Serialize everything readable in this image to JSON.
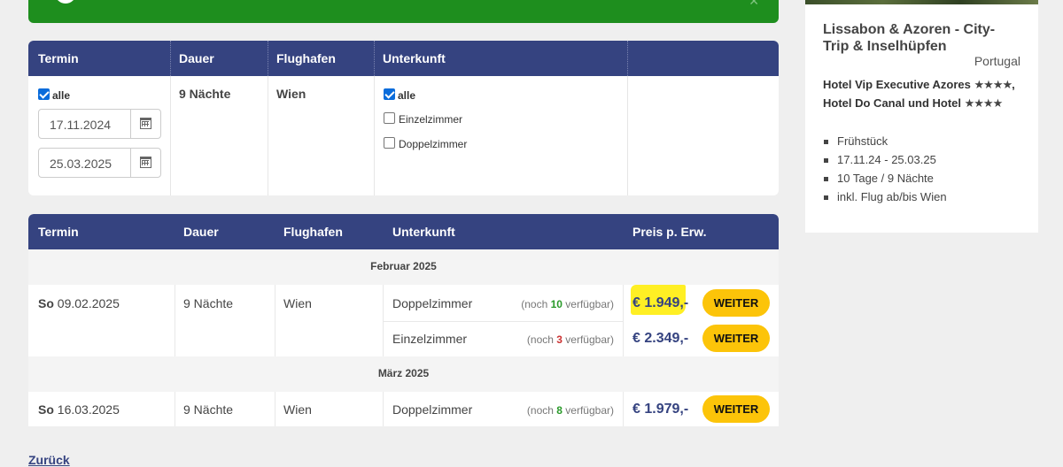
{
  "filter": {
    "headers": [
      "Termin",
      "Dauer",
      "Flughafen",
      "Unterkunft",
      ""
    ],
    "termin_all_label": "alle",
    "date_from": "17.11.2024",
    "date_to": "25.03.2025",
    "dauer": "9 Nächte",
    "flughafen": "Wien",
    "unterkunft_options": [
      {
        "label": "alle",
        "checked": true
      },
      {
        "label": "Einzelzimmer",
        "checked": false
      },
      {
        "label": "Doppelzimmer",
        "checked": false
      }
    ]
  },
  "results": {
    "headers": [
      "Termin",
      "Dauer",
      "Flughafen",
      "Unterkunft",
      "Preis p. Erw."
    ],
    "months": [
      {
        "label": "Februar 2025",
        "rows": [
          {
            "weekday": "So",
            "date": "09.02.2025",
            "dauer": "9 Nächte",
            "flughafen": "Wien",
            "options": [
              {
                "room": "Doppelzimmer",
                "avail_prefix": "(noch ",
                "avail_count": "10",
                "avail_suffix": " verfügbar)",
                "price": "€ 1.949,-",
                "button": "WEITER"
              },
              {
                "room": "Einzelzimmer",
                "avail_prefix": "(noch ",
                "avail_count": "3",
                "avail_suffix": " verfügbar)",
                "price": "€ 2.349,-",
                "button": "WEITER"
              }
            ]
          }
        ]
      },
      {
        "label": "März 2025",
        "rows": [
          {
            "weekday": "So",
            "date": "16.03.2025",
            "dauer": "9 Nächte",
            "flughafen": "Wien",
            "options": [
              {
                "room": "Doppelzimmer",
                "avail_prefix": "(noch ",
                "avail_count": "8",
                "avail_suffix": " verfügbar)",
                "price": "€ 1.979,-",
                "button": "WEITER"
              }
            ]
          }
        ]
      }
    ]
  },
  "back_link": "Zurück",
  "card": {
    "title": "Lissabon & Azoren - City-Trip & Inselhüpfen",
    "country": "Portugal",
    "hotel_part1": "Hotel Vip Executive Azores ",
    "hotel_stars1": "★★★★",
    "hotel_part2": ", Hotel Do Canal und Hotel ",
    "hotel_stars2": "★★★★",
    "features": [
      "Frühstück",
      "17.11.24 - 25.03.25",
      "10 Tage / 9 Nächte",
      "inkl. Flug ab/bis Wien"
    ]
  },
  "colors": {
    "header": "#354380",
    "button": "#fcc409",
    "success": "#1e8e1e",
    "highlight": "#ffef24"
  },
  "icons": [
    "calendar-icon",
    "close-icon",
    "info-icon"
  ]
}
